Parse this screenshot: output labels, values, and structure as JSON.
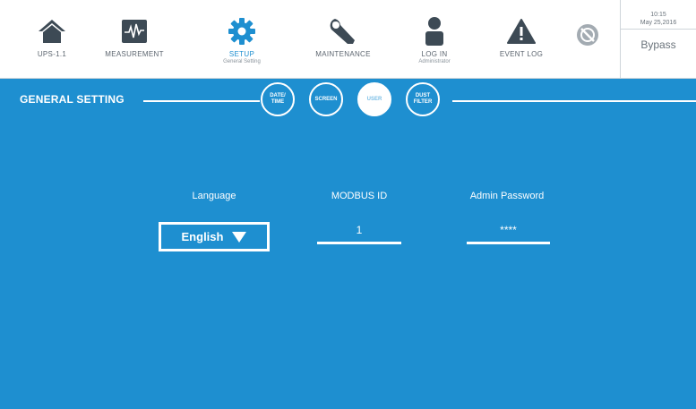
{
  "nav": {
    "items": [
      {
        "label": "UPS-1.1",
        "sub": "",
        "icon": "home-icon"
      },
      {
        "label": "MEASUREMENT",
        "sub": "",
        "icon": "waveform-icon"
      },
      {
        "label": "SETUP",
        "sub": "General Setting",
        "icon": "gear-icon"
      },
      {
        "label": "MAINTENANCE",
        "sub": "",
        "icon": "wrench-icon"
      },
      {
        "label": "LOG IN",
        "sub": "Administrator",
        "icon": "user-icon"
      },
      {
        "label": "EVENT LOG",
        "sub": "",
        "icon": "warning-icon"
      }
    ],
    "mute_icon": "mute-icon",
    "active_index": 2
  },
  "status": {
    "time": "10:15",
    "date": "May 25,2016",
    "mode": "Bypass"
  },
  "section": {
    "title": "GENERAL SETTING",
    "tabs": [
      {
        "line1": "DATE/",
        "line2": "TIME"
      },
      {
        "line1": "SCREEN",
        "line2": ""
      },
      {
        "line1": "USER",
        "line2": ""
      },
      {
        "line1": "DUST",
        "line2": "FILTER"
      }
    ],
    "active_tab": 2
  },
  "form": {
    "language_label": "Language",
    "language_value": "English",
    "modbus_label": "MODBUS ID",
    "modbus_value": "1",
    "password_label": "Admin Password",
    "password_value": "****"
  },
  "colors": {
    "accent": "#1e8fd0",
    "icon_dark": "#3d4a55",
    "text_gray": "#5d6670"
  }
}
